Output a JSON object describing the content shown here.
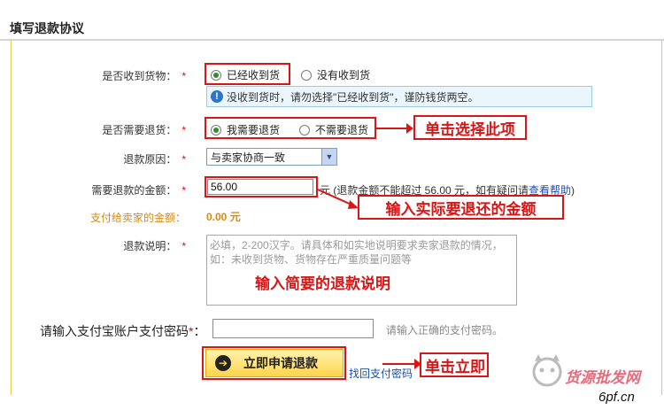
{
  "header": {
    "title": "填写退款协议"
  },
  "form": {
    "received_goods": {
      "label": "是否收到货物：",
      "required_mark": "*",
      "options": [
        "已经收到货",
        "没有收到货"
      ],
      "selected": "已经收到货",
      "notice": "没收到货时，请勿选择\"已经收到货\"，谨防钱货两空。"
    },
    "need_return": {
      "label": "是否需要退货：",
      "required_mark": "*",
      "options": [
        "我需要退货",
        "不需要退货"
      ],
      "selected": "我需要退货"
    },
    "reason": {
      "label": "退款原因：",
      "required_mark": "*",
      "value": "与卖家协商一致"
    },
    "refund_amount": {
      "label": "需要退款的金额：",
      "required_mark": "*",
      "value": "56.00",
      "hint_prefix": "元 (退款金额不能超过 56.00 元，如有疑问请",
      "hint_link": "查看帮助",
      "hint_suffix": ")"
    },
    "pay_to_seller": {
      "label": "支付给卖家的金额：",
      "value": "0.00 元"
    },
    "explanation": {
      "label": "退款说明：",
      "required_mark": "*",
      "placeholder_line1": "必填，2-200汉字。请具体和如实地说明要求卖家退款的情况，",
      "placeholder_line2": "如：未收到货物、货物存在严重质量问题等"
    },
    "password": {
      "label": "请输入支付宝账户支付密码",
      "required_mark": "*",
      "colon": "：",
      "value": "",
      "hint": "请输入正确的支付密码。"
    },
    "submit_label": "立即申请退款",
    "back_link": "找回支付密码"
  },
  "annotations": {
    "select_item": "单击选择此项",
    "enter_amount": "输入实际要退还的金额",
    "enter_explanation": "输入简要的退款说明",
    "click_submit": "单击立即"
  },
  "watermark": {
    "text": "货源批发网",
    "url": "6pf.cn"
  },
  "colors": {
    "annotation_red": "#d91515",
    "amount_orange": "#d58a13",
    "link_blue": "#1a4db0",
    "button_yellow": "#ffd44a"
  }
}
